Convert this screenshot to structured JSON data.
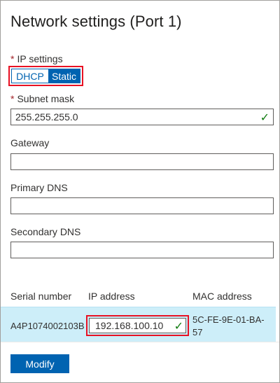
{
  "panel": {
    "title": "Network settings (Port 1)"
  },
  "ip_settings": {
    "label": "IP settings",
    "required_mark": "*",
    "options": [
      "DHCP",
      "Static"
    ],
    "selected": "Static"
  },
  "subnet": {
    "label": "Subnet mask",
    "required_mark": "*",
    "value": "255.255.255.0",
    "check": "✓"
  },
  "gateway": {
    "label": "Gateway",
    "value": ""
  },
  "primary_dns": {
    "label": "Primary DNS",
    "value": ""
  },
  "secondary_dns": {
    "label": "Secondary DNS",
    "value": ""
  },
  "table": {
    "headers": [
      "Serial number",
      "IP address",
      "MAC address"
    ],
    "row": {
      "serial": "A4P1074002103B",
      "ip": "192.168.100.10",
      "ip_check": "✓",
      "mac_line1": "5C-FE-9E-01-BA-",
      "mac_line2": "57"
    }
  },
  "actions": {
    "modify_label": "Modify"
  },
  "colors": {
    "accent": "#0063b1",
    "highlight": "#e81123",
    "valid": "#107c10",
    "row_selected": "#cdeef9"
  }
}
